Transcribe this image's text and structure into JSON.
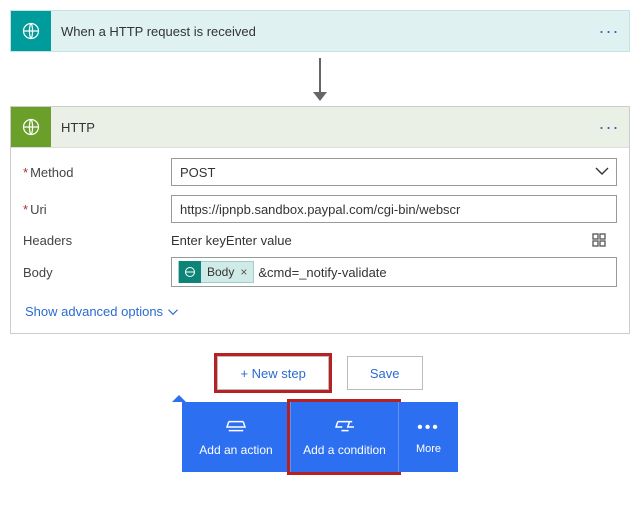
{
  "trigger": {
    "title": "When a HTTP request is received"
  },
  "http": {
    "title": "HTTP",
    "method_label": "Method",
    "method_value": "POST",
    "uri_label": "Uri",
    "uri_value": "https://ipnpb.sandbox.paypal.com/cgi-bin/webscr",
    "headers_label": "Headers",
    "headers_key_placeholder": "Enter key",
    "headers_value_placeholder": "Enter value",
    "body_label": "Body",
    "body_token": "Body",
    "body_suffix": "&cmd=_notify-validate",
    "advanced": "Show advanced options"
  },
  "buttons": {
    "new_step": "+ New step",
    "save": "Save"
  },
  "actionbar": {
    "add_action": "Add an action",
    "add_condition": "Add a condition",
    "more": "More"
  }
}
